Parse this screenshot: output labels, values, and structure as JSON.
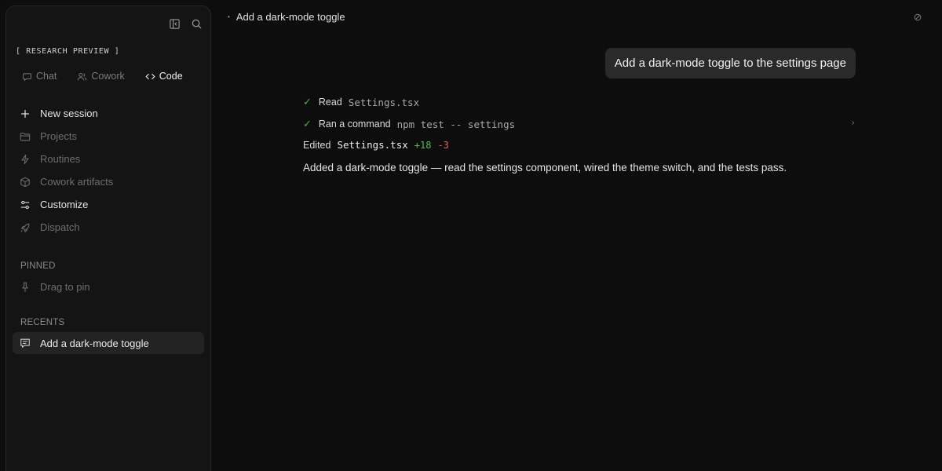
{
  "sidebar": {
    "research_label": "[ RESEARCH PREVIEW ]",
    "tabs": [
      {
        "label": "Chat",
        "icon": "chat-bubble-icon"
      },
      {
        "label": "Cowork",
        "icon": "people-icon"
      },
      {
        "label": "Code",
        "icon": "code-brackets-icon"
      }
    ],
    "nav": [
      {
        "label": "New session",
        "icon": "plus-icon"
      },
      {
        "label": "Projects",
        "icon": "folder-icon"
      },
      {
        "label": "Routines",
        "icon": "lightning-icon"
      },
      {
        "label": "Cowork artifacts",
        "icon": "cube-icon"
      },
      {
        "label": "Customize",
        "icon": "sliders-icon"
      },
      {
        "label": "Dispatch",
        "icon": "rocket-icon"
      }
    ],
    "pinned_label": "PINNED",
    "pinned_item": "Drag to pin",
    "recents_label": "RECENTS",
    "recent_item": "Add a dark-mode toggle"
  },
  "header": {
    "title": "Add a dark-mode toggle"
  },
  "conversation": {
    "user_message": "Add a dark-mode toggle to the settings page",
    "steps": [
      {
        "check": "✓",
        "action": "Read",
        "detail": "Settings.tsx"
      },
      {
        "check": "✓",
        "action": "Ran a command",
        "detail": "npm test -- settings"
      }
    ],
    "edit": {
      "action": "Edited",
      "file": "Settings.tsx",
      "added": "+18",
      "removed": "-3"
    },
    "summary": "Added a dark-mode toggle — read the settings component, wired the theme switch, and the tests pass."
  },
  "colors": {
    "background": "#0d0d0d",
    "sidebar": "#141414",
    "check_green": "#4caf50",
    "added_green": "#57b85c",
    "removed_red": "#e0605a"
  }
}
